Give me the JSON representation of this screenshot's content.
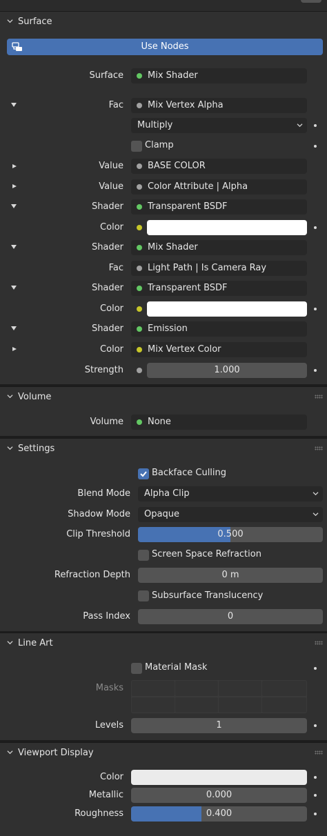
{
  "surface_panel": {
    "title": "Surface",
    "use_nodes_label": "Use Nodes",
    "surface_label": "Surface",
    "surface_value": "Mix Shader",
    "fac_label": "Fac",
    "fac_value": "Mix Vertex Alpha",
    "blend_op": "Multiply",
    "clamp_label": "Clamp",
    "value1_label": "Value",
    "value1_value": "BASE COLOR",
    "value2_label": "Value",
    "value2_value": "Color Attribute | Alpha",
    "shader1_label": "Shader",
    "shader1_value": "Transparent BSDF",
    "color1_label": "Color",
    "shader2_label": "Shader",
    "shader2_value": "Mix Shader",
    "fac2_label": "Fac",
    "fac2_value": "Light Path | Is Camera Ray",
    "shader3_label": "Shader",
    "shader3_value": "Transparent BSDF",
    "color2_label": "Color",
    "shader4_label": "Shader",
    "shader4_value": "Emission",
    "color3_label": "Color",
    "color3_value": "Mix Vertex Color",
    "strength_label": "Strength",
    "strength_value": "1.000"
  },
  "volume_panel": {
    "title": "Volume",
    "volume_label": "Volume",
    "volume_value": "None"
  },
  "settings_panel": {
    "title": "Settings",
    "backface_label": "Backface Culling",
    "backface_checked": true,
    "blend_mode_label": "Blend Mode",
    "blend_mode_value": "Alpha Clip",
    "shadow_mode_label": "Shadow Mode",
    "shadow_mode_value": "Opaque",
    "clip_threshold_label": "Clip Threshold",
    "clip_threshold_value": "0.500",
    "clip_threshold_fraction": 0.5,
    "ssr_label": "Screen Space Refraction",
    "refraction_depth_label": "Refraction Depth",
    "refraction_depth_value": "0 m",
    "subsurface_label": "Subsurface Translucency",
    "pass_index_label": "Pass Index",
    "pass_index_value": "0"
  },
  "lineart_panel": {
    "title": "Line Art",
    "material_mask_label": "Material Mask",
    "masks_label": "Masks",
    "levels_label": "Levels",
    "levels_value": "1"
  },
  "viewport_panel": {
    "title": "Viewport Display",
    "color_label": "Color",
    "metallic_label": "Metallic",
    "metallic_value": "0.000",
    "metallic_fraction": 0.0,
    "roughness_label": "Roughness",
    "roughness_value": "0.400",
    "roughness_fraction": 0.4
  },
  "colors": {
    "accent": "#4772b3",
    "socket_shader": "#63c763",
    "socket_float": "#a1a1a1",
    "socket_color": "#c7c729",
    "panel_bg": "#303030",
    "field_bg": "#282828"
  }
}
